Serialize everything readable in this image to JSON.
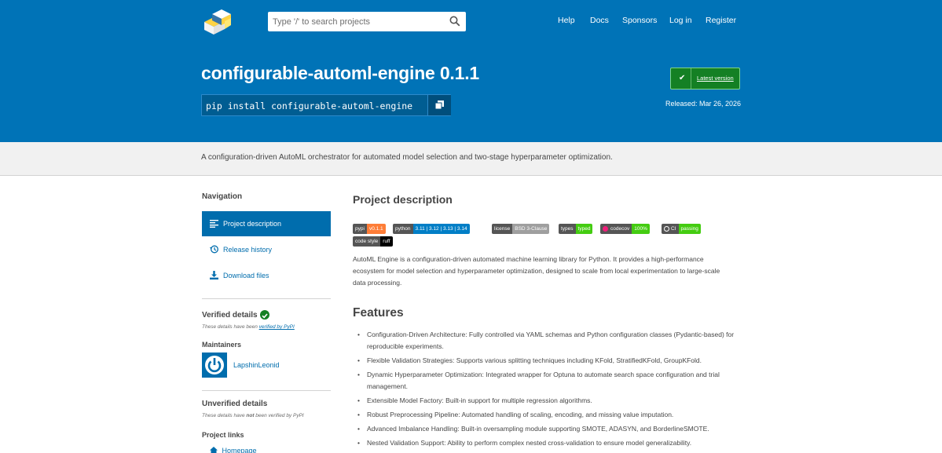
{
  "header": {
    "search_placeholder": "Type '/' to search projects",
    "nav": [
      "Help",
      "Docs",
      "Sponsors",
      "Log in",
      "Register"
    ]
  },
  "package": {
    "title": "configurable-automl-engine 0.1.1",
    "pip_command": "pip install configurable-automl-engine",
    "latest_label": "Latest version",
    "released": "Released: Mar 26, 2026",
    "summary": "A configuration-driven AutoML orchestrator for automated model selection and two-stage hyperparameter optimization."
  },
  "sidebar": {
    "navigation_heading": "Navigation",
    "items": [
      {
        "label": "Project description",
        "icon": "align-left-icon"
      },
      {
        "label": "Release history",
        "icon": "history-icon"
      },
      {
        "label": "Download files",
        "icon": "download-icon"
      }
    ],
    "verified_heading": "Verified details",
    "verified_note_prefix": "These details have been ",
    "verified_note_link": "verified by PyPI",
    "maintainers_heading": "Maintainers",
    "maintainer": "LapshinLeonid",
    "unverified_heading": "Unverified details",
    "unverified_note_a": "These details have ",
    "unverified_note_b": "not",
    "unverified_note_c": " been verified by PyPI",
    "project_links_heading": "Project links",
    "homepage": "Homepage"
  },
  "badges": [
    {
      "left": "pypi",
      "right": "v0.1.1",
      "color": "#fe7d37"
    },
    {
      "left": "python",
      "right": "3.11 | 3.12 | 3.13 | 3.14",
      "color": "#007ec6"
    },
    {
      "left": "license",
      "right": "BSD 3-Clause",
      "color": "#9f9f9f"
    },
    {
      "left": "types",
      "right": "typed",
      "color": "#4c1"
    },
    {
      "left": "codecov",
      "right": "100%",
      "color": "#4c1"
    },
    {
      "left": "CI",
      "right": "passing",
      "color": "#4c1"
    },
    {
      "left": "code style",
      "right": "ruff",
      "color": "#000000"
    }
  ],
  "main": {
    "description_heading": "Project description",
    "intro": "AutoML Engine is a configuration-driven automated machine learning library for Python. It provides a high-performance ecosystem for model selection and hyperparameter optimization, designed to scale from local experimentation to large-scale data processing.",
    "features_heading": "Features",
    "features": [
      "Configuration-Driven Architecture: Fully controlled via YAML schemas and Python configuration classes (Pydantic-based) for reproducible experiments.",
      "Flexible Validation Strategies: Supports various splitting techniques including KFold, StratifiedKFold, GroupKFold.",
      "Dynamic Hyperparameter Optimization: Integrated wrapper for Optuna to automate search space configuration and trial management.",
      "Extensible Model Factory: Built-in support for multiple regression algorithms.",
      "Robust Preprocessing Pipeline: Automated handling of scaling, encoding, and missing value imputation.",
      "Advanced Imbalance Handling: Built-in oversampling module supporting SMOTE, ADASYN, and BorderlineSMOTE.",
      "Nested Validation Support: Ability to perform complex nested cross-validation to ensure model generalizability."
    ]
  },
  "colors": {
    "brand_blue": "#0073b7",
    "link_blue": "#006dad",
    "success_green": "#148024"
  }
}
